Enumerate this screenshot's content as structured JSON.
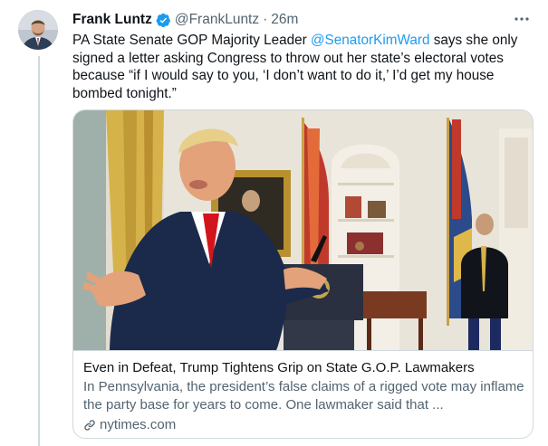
{
  "tweet": {
    "author_name": "Frank Luntz",
    "handle": "@FrankLuntz",
    "separator": "·",
    "time": "26m",
    "text_parts": {
      "before_mention": "PA State Senate GOP Majority Leader ",
      "mention": "@SenatorKimWard",
      "after_mention": " says she only signed a letter asking Congress to throw out her state’s electoral votes because “if I would say to you, ‘I don’t want to do it,’ I’d get my house bombed tonight.”"
    }
  },
  "card": {
    "title": "Even in Defeat, Trump Tightens Grip on State G.O.P. Lawmakers",
    "description": "In Pennsylvania, the president’s false claims of a rigged vote may inflame the party base for years to come. One lawmaker said that ...",
    "domain": "nytimes.com"
  },
  "icons": {
    "verified": "verified-badge-icon",
    "more": "more-options-icon",
    "link": "link-icon"
  },
  "colors": {
    "accent": "#1d9bf0",
    "text_primary": "#0f1419",
    "text_secondary": "#536471",
    "border": "#cfd9de"
  }
}
